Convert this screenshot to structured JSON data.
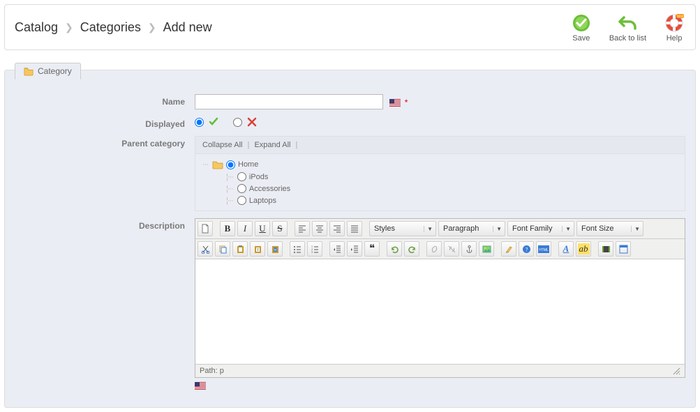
{
  "breadcrumb": {
    "a": "Catalog",
    "b": "Categories",
    "c": "Add new"
  },
  "actions": {
    "save": "Save",
    "back": "Back to list",
    "help": "Help"
  },
  "tab": {
    "label": "Category"
  },
  "form": {
    "name_label": "Name",
    "name_value": "",
    "required": "*",
    "displayed_label": "Displayed",
    "parent_label": "Parent category",
    "desc_label": "Description"
  },
  "tree": {
    "collapse": "Collapse All",
    "expand": "Expand All",
    "root": "Home",
    "children": [
      "iPods",
      "Accessories",
      "Laptops"
    ]
  },
  "editor": {
    "styles": "Styles",
    "paragraph": "Paragraph",
    "fontfamily": "Font Family",
    "fontsize": "Font Size",
    "path": "Path: p"
  }
}
